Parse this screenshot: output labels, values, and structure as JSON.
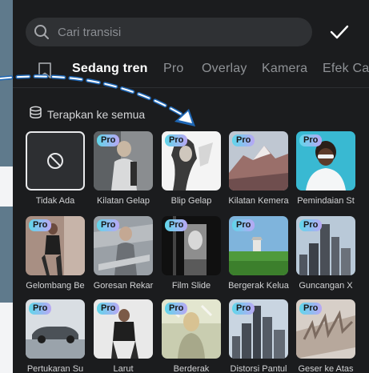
{
  "search": {
    "placeholder": "Cari transisi"
  },
  "icons": {
    "search": "search-icon",
    "confirm": "checkmark-icon",
    "favorites": "bookmark-icon",
    "apply_all": "layers-icon",
    "none": "no-entry-icon"
  },
  "tabs": [
    {
      "label": "Sedang tren",
      "active": true
    },
    {
      "label": "Pro",
      "active": false
    },
    {
      "label": "Overlay",
      "active": false
    },
    {
      "label": "Kamera",
      "active": false
    },
    {
      "label": "Efek Ca",
      "active": false
    }
  ],
  "apply_all_label": "Terapkan ke semua",
  "badge_label": "Pro",
  "items": [
    {
      "label": "Tidak Ada",
      "pro": false,
      "selected": true
    },
    {
      "label": "Kilatan Gelap",
      "pro": true
    },
    {
      "label": "Blip Gelap",
      "pro": true
    },
    {
      "label": "Kilatan Kemera",
      "pro": true
    },
    {
      "label": "Pemindaian St",
      "pro": true
    },
    {
      "label": "Gelombang Be",
      "pro": true
    },
    {
      "label": "Goresan Rekar",
      "pro": true
    },
    {
      "label": "Film Slide",
      "pro": true
    },
    {
      "label": "Bergerak Kelua",
      "pro": true
    },
    {
      "label": "Guncangan X",
      "pro": true
    },
    {
      "label": "Pertukaran Su",
      "pro": true
    },
    {
      "label": "Larut",
      "pro": true
    },
    {
      "label": "Berderak",
      "pro": true
    },
    {
      "label": "Distorsi Pantul",
      "pro": true
    },
    {
      "label": "Geser ke Atas",
      "pro": true
    }
  ],
  "colors": {
    "panel_bg": "#1b1c1e",
    "badge_gradient_start": "#5fd7ea",
    "badge_gradient_end": "#b9a7f4",
    "overlay_arrow": "#1f67b5"
  }
}
